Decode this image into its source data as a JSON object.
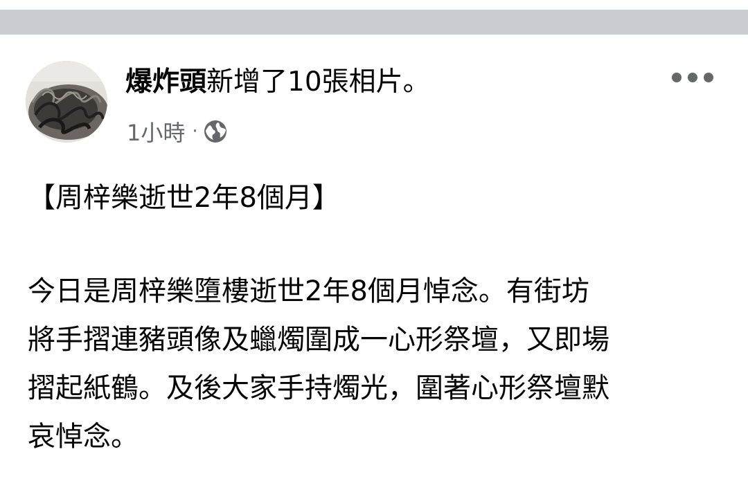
{
  "post": {
    "author": "爆炸頭",
    "action": "新增了10張相片。",
    "time": "1小時",
    "separator": "·",
    "audience_icon": "globe-icon",
    "more_icon": "more-options-icon",
    "title": "【周梓樂逝世2年8個月】",
    "body_lines": [
      "今日是周梓樂墮樓逝世2年8個月悼念。有街坊",
      "將手摺連豬頭像及蠟燭圍成一心形祭壇，又即場",
      "摺起紙鶴。及後大家手持燭光，圍著心形祭壇默",
      "哀悼念。"
    ]
  },
  "colors": {
    "top_bar": "#c9ccd1",
    "secondary_text": "#65676b",
    "primary_text": "#050505"
  }
}
